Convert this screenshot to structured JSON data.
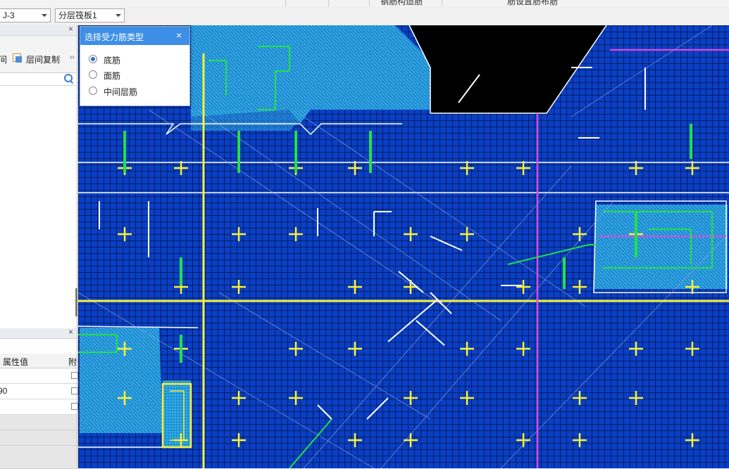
{
  "toolbar": {
    "floor_combo_value": "J-3",
    "component_combo_value": "分层筏板1"
  },
  "top_strip": {
    "cut_text_left": "钢筋构造筋",
    "cut_text_right": "筋设置筋布筋"
  },
  "left_panel": {
    "tool_cut_label": "间",
    "tool_copy_label": "层间复制",
    "more_label": "››"
  },
  "properties": {
    "col_value": "属性值",
    "col_attach": "附",
    "rows": [
      "",
      "90",
      ""
    ]
  },
  "dialog": {
    "title": "选择受力筋类型",
    "close": "×",
    "options": [
      {
        "label": "底筋",
        "selected": true
      },
      {
        "label": "面筋",
        "selected": false
      },
      {
        "label": "中间层筋",
        "selected": false
      }
    ]
  },
  "colors": {
    "canvas_bg": "#0a3fc6",
    "grid": "#000000",
    "yellow": "#f7f23a",
    "green": "#22e04a",
    "magenta": "#d64ae0",
    "white": "#ffffff",
    "dialog_title": "#3d8ee6"
  }
}
